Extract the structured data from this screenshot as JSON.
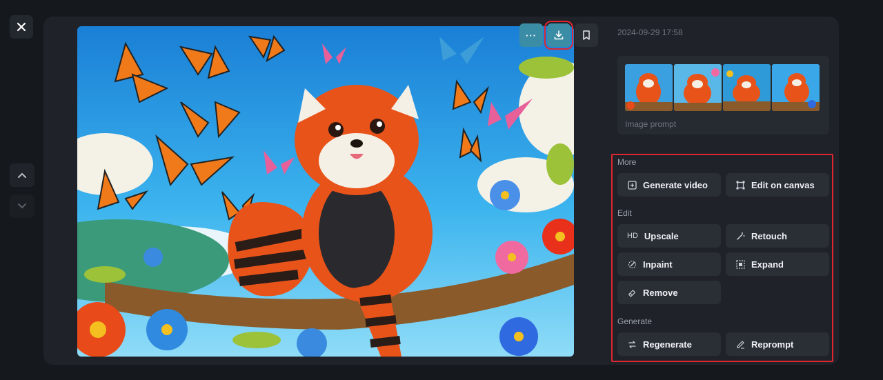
{
  "timestamp": "2024-09-29 17:58",
  "prompt_label": "Image prompt",
  "toolbar": {
    "more_label": "···"
  },
  "sections": {
    "more": "More",
    "edit": "Edit",
    "generate": "Generate"
  },
  "buttons": {
    "generate_video": "Generate video",
    "edit_on_canvas": "Edit on canvas",
    "upscale": "Upscale",
    "upscale_prefix": "HD",
    "retouch": "Retouch",
    "inpaint": "Inpaint",
    "expand": "Expand",
    "remove": "Remove",
    "regenerate": "Regenerate",
    "reprompt": "Reprompt"
  },
  "colors": {
    "accent_teal": "#3b8da5",
    "highlight_red": "#e0262f"
  }
}
